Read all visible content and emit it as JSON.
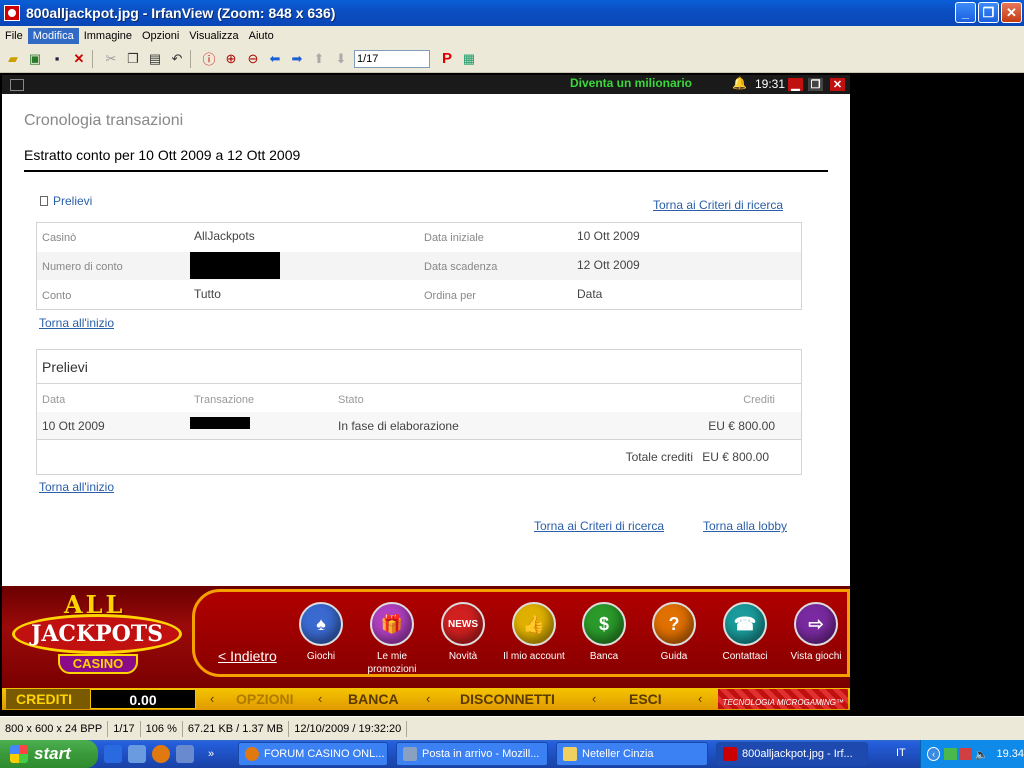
{
  "window": {
    "title": "800alljackpot.jpg - IrfanView (Zoom: 848 x 636)"
  },
  "menu": [
    "File",
    "Modifica",
    "Immagine",
    "Opzioni",
    "Visualizza",
    "Aiuto"
  ],
  "toolbar": {
    "page_counter": "1/17"
  },
  "casino": {
    "slogan": "Diventa un milionario",
    "clock": "19:31",
    "page_title": "Cronologia transazioni",
    "statement": "Estratto conto per 10 Ott 2009 a 12 Ott 2009",
    "prelievi_tag": "Prelievi",
    "back_to_criteria": "Torna ai Criteri di ricerca",
    "back_to_top": "Torna all'inizio",
    "back_to_lobby": "Torna alla lobby",
    "info": {
      "casino_label": "Casinò",
      "casino_value": "AllJackpots",
      "start_label": "Data iniziale",
      "start_value": "10 Ott 2009",
      "account_no_label": "Numero di conto",
      "end_label": "Data scadenza",
      "end_value": "12 Ott 2009",
      "account_label": "Conto",
      "account_value": "Tutto",
      "order_label": "Ordina per",
      "order_value": "Data"
    },
    "transactions": {
      "heading": "Prelievi",
      "columns": [
        "Data",
        "Transazione",
        "Stato",
        "Crediti"
      ],
      "rows": [
        {
          "date": "10 Ott 2009",
          "status": "In fase di elaborazione",
          "credits": "EU € 800.00"
        }
      ],
      "total_label": "Totale crediti",
      "total_value": "EU € 800.00"
    },
    "footer": {
      "logo_all": "ALL",
      "logo_jackpots": "JACKPOTS",
      "logo_casino": "CASINO",
      "back": "< Indietro",
      "nav": [
        {
          "label": "Giochi",
          "icon": "cards-icon",
          "color": "#3a6ad0"
        },
        {
          "label": "Le mie promozioni",
          "icon": "gift-icon",
          "color": "#b040c0"
        },
        {
          "label": "Novità",
          "icon": "news-icon",
          "color": "#d02020"
        },
        {
          "label": "Il mio account",
          "icon": "thumbs-up-icon",
          "color": "#e0b000"
        },
        {
          "label": "Banca",
          "icon": "dollar-icon",
          "color": "#2a9a2a"
        },
        {
          "label": "Guida",
          "icon": "question-icon",
          "color": "#e07000"
        },
        {
          "label": "Contattaci",
          "icon": "phone-icon",
          "color": "#1a9a9a"
        },
        {
          "label": "Vista giochi",
          "icon": "exit-icon",
          "color": "#7a2aa0"
        }
      ],
      "credits_label": "CREDITI",
      "credits_value": "0.00",
      "bar_items": [
        "OPZIONI",
        "BANCA",
        "DISCONNETTI",
        "ESCI"
      ],
      "microgaming": "TECNOLOGIA MICROGAMING™"
    }
  },
  "status": [
    "800 x 600 x 24 BPP",
    "1/17",
    "106 %",
    "67.21 KB / 1.37 MB",
    "12/10/2009 / 19:32:20"
  ],
  "taskbar": {
    "start": "start",
    "tasks": [
      "FORUM CASINO ONL...",
      "Posta in arrivo - Mozill...",
      "Neteller Cinzia",
      "800alljackpot.jpg - Irf..."
    ],
    "lang": "IT",
    "clock": "19.34"
  }
}
